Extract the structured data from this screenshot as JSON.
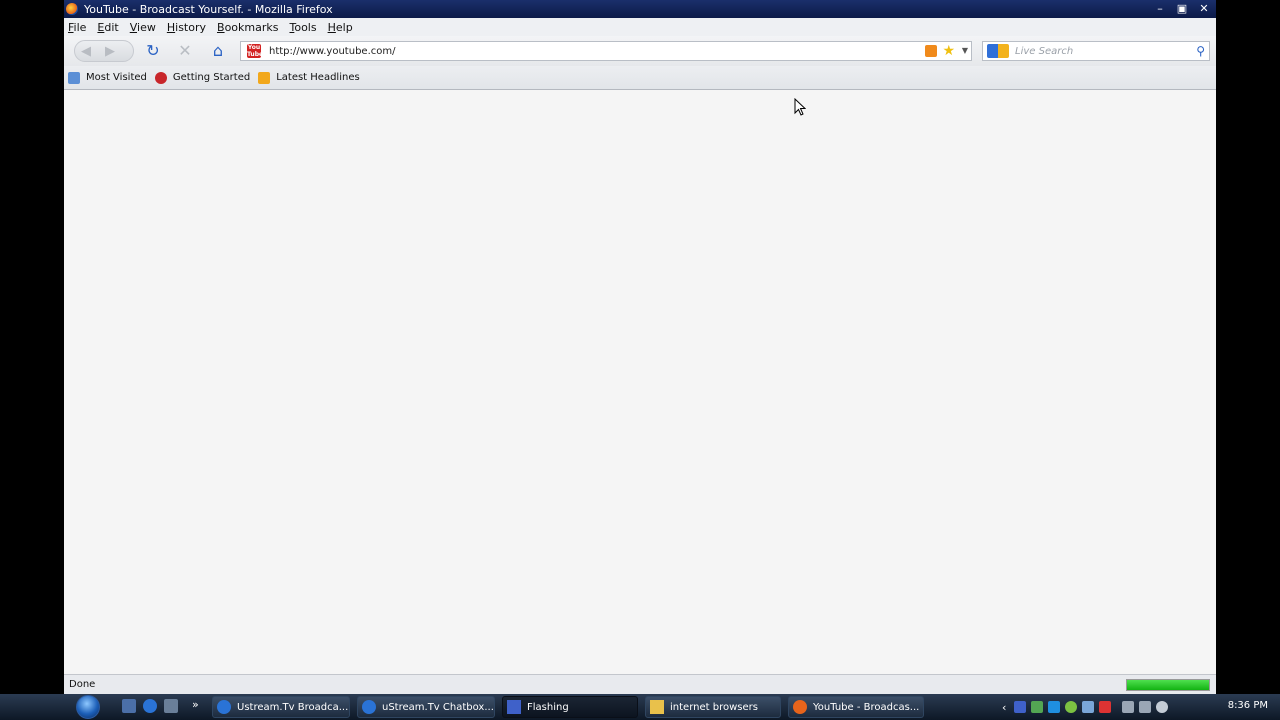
{
  "window": {
    "title": "YouTube - Broadcast Yourself. - Mozilla Firefox",
    "buttons": {
      "minimize": "–",
      "restore": "▣",
      "close": "✕"
    }
  },
  "menu": {
    "items": [
      {
        "label": "File",
        "accel": "F",
        "rest": "ile"
      },
      {
        "label": "Edit",
        "accel": "E",
        "rest": "dit"
      },
      {
        "label": "View",
        "accel": "V",
        "rest": "iew"
      },
      {
        "label": "History",
        "accel": "H",
        "rest": "istory"
      },
      {
        "label": "Bookmarks",
        "accel": "B",
        "rest": "ookmarks"
      },
      {
        "label": "Tools",
        "accel": "T",
        "rest": "ools"
      },
      {
        "label": "Help",
        "accel": "H",
        "rest": "elp"
      }
    ]
  },
  "nav": {
    "url": "http://www.youtube.com/",
    "search_placeholder": "Live Search",
    "icons": {
      "back": "back-icon",
      "forward": "forward-icon",
      "reload": "reload-icon",
      "stop": "stop-icon",
      "home": "home-icon",
      "rss": "rss-feed-icon",
      "star": "bookmark-star-icon",
      "search_go": "magnifier-icon"
    }
  },
  "bookmarks": [
    {
      "label": "Most Visited",
      "color": "#5b8fd6"
    },
    {
      "label": "Getting Started",
      "color": "#c8262b"
    },
    {
      "label": "Latest Headlines",
      "color": "#f2a81c"
    }
  ],
  "status": {
    "text": "Done",
    "progress": 1.0,
    "progress_color": "#1fbf1f"
  },
  "taskbar": {
    "tasks": [
      {
        "label": "Ustream.Tv Broadca...",
        "active": false,
        "icon_color": "#2a73d6"
      },
      {
        "label": "uStream.Tv Chatbox...",
        "active": false,
        "icon_color": "#2a73d6"
      },
      {
        "label": "Flashing",
        "active": true,
        "icon_color": "#3f61c9"
      },
      {
        "label": "internet browsers",
        "active": false,
        "icon_color": "#e9c14b"
      },
      {
        "label": "YouTube - Broadcas...",
        "active": false,
        "icon_color": "#e8641b"
      }
    ],
    "clock": "8:36 PM"
  }
}
